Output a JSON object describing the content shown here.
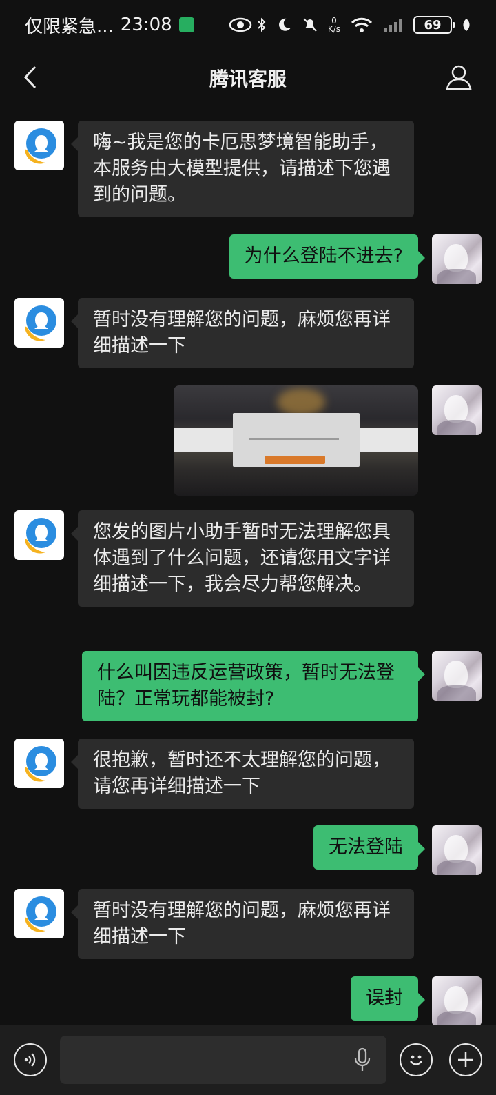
{
  "status_bar": {
    "carrier": "仅限紧急...",
    "time": "23:08",
    "net_speed_value": "0",
    "net_speed_unit": "K/s",
    "battery": "69"
  },
  "header": {
    "title": "腾讯客服"
  },
  "messages": [
    {
      "sender": "bot",
      "type": "text",
      "text": "嗨~我是您的卡厄思梦境智能助手，本服务由大模型提供，请描述下您遇到的问题。"
    },
    {
      "sender": "user",
      "type": "text",
      "text": "为什么登陆不进去?"
    },
    {
      "sender": "bot",
      "type": "text",
      "text": "暂时没有理解您的问题，麻烦您再详细描述一下"
    },
    {
      "sender": "user",
      "type": "image",
      "text": ""
    },
    {
      "sender": "bot",
      "type": "text",
      "text": "您发的图片小助手暂时无法理解您具体遇到了什么问题，还请您用文字详细描述一下，我会尽力帮您解决。"
    },
    {
      "sender": "user",
      "type": "text",
      "text": "什么叫因违反运营政策，暂时无法登陆？正常玩都能被封?"
    },
    {
      "sender": "bot",
      "type": "text",
      "text": "很抱歉，暂时还不太理解您的问题，请您再详细描述一下"
    },
    {
      "sender": "user",
      "type": "text",
      "text": "无法登陆"
    },
    {
      "sender": "bot",
      "type": "text",
      "text": "暂时没有理解您的问题，麻烦您再详细描述一下"
    },
    {
      "sender": "user",
      "type": "text",
      "text": "误封"
    }
  ],
  "input_bar": {
    "value": "",
    "placeholder": ""
  },
  "icons": {
    "back": "chevron-left-icon",
    "profile": "person-icon",
    "voice": "voice-icon",
    "mic": "microphone-icon",
    "emoji": "emoji-icon",
    "plus": "plus-icon"
  },
  "colors": {
    "background": "#111111",
    "bubble_in": "#2c2c2c",
    "bubble_out": "#3dbd72",
    "input_bar": "#1e1e1e"
  }
}
